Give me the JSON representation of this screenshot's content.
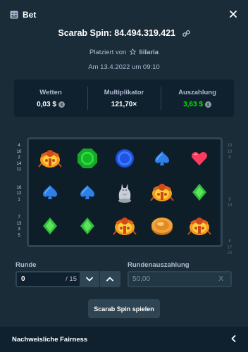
{
  "header": {
    "title": "Bet",
    "icons": {
      "bet": "bet-slip-icon",
      "close": "close-icon"
    }
  },
  "spin": {
    "title": "Scarab Spin: 84.494.319.421",
    "link_icon": "link-icon"
  },
  "placed": {
    "prefix": "Platziert von",
    "star_icon": "star-icon",
    "user": "liilaria"
  },
  "date": "Am 13.4.2022 um 09:10",
  "stats": {
    "bet_label": "Wetten",
    "bet_value": "0,03 $",
    "multiplier_label": "Multiplikator",
    "multiplier_value": "121,70×",
    "payout_label": "Auszahlung",
    "payout_value": "3,63 $",
    "coin_icon": "coin-icon"
  },
  "paylines_left": [
    "4",
    "10",
    "2",
    "14",
    "11",
    "",
    "",
    "16",
    "12",
    "1",
    "",
    "",
    "7",
    "13",
    "3",
    "5"
  ],
  "paylines_right": [
    "18",
    "19",
    "6",
    "",
    "",
    "",
    "",
    "",
    "",
    "9",
    "19",
    "",
    "",
    "",
    "",
    "",
    "8",
    "17",
    "20"
  ],
  "reels": [
    [
      "scarab",
      "emerald",
      "sapphire",
      "spade",
      "heart"
    ],
    [
      "spade",
      "spade",
      "cat-statue",
      "scarab",
      "diamond"
    ],
    [
      "diamond",
      "diamond",
      "scarab",
      "gold-coin",
      "scarab"
    ]
  ],
  "colors": {
    "payout_green": "#00e701",
    "background": "#1a2c38",
    "panel": "#0f212e"
  },
  "round": {
    "label": "Runde",
    "value": "0",
    "total": "/ 15",
    "down_icon": "chevron-down-icon",
    "up_icon": "chevron-up-icon"
  },
  "round_payout": {
    "label": "Rundenauszahlung",
    "value": "50,00",
    "suffix": "X"
  },
  "play_button": "Scarab Spin spielen",
  "footer": {
    "title": "Nachweisliche Fairness",
    "icon": "chevron-left-icon"
  }
}
